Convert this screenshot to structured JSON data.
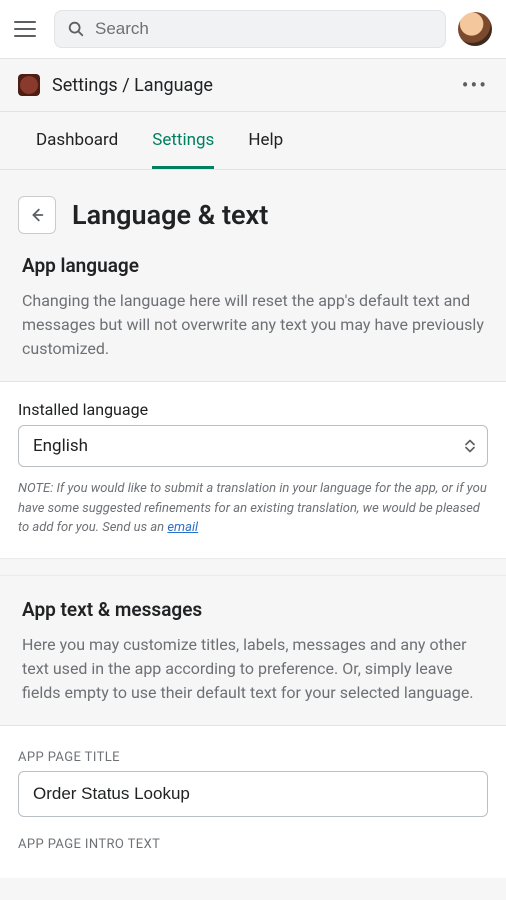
{
  "topbar": {
    "search_placeholder": "Search"
  },
  "breadcrumb": {
    "text": "Settings / Language"
  },
  "tabs": {
    "dashboard": "Dashboard",
    "settings": "Settings",
    "help": "Help"
  },
  "page": {
    "title": "Language & text"
  },
  "app_language": {
    "title": "App language",
    "description": "Changing the language here will reset the app's default text and messages but will not overwrite any text you may have previously customized.",
    "installed_label": "Installed language",
    "selected": "English",
    "note_prefix": "NOTE: If you would like to submit a translation in your language for the app, or if you have some suggested refinements for an existing translation, we would be pleased to add for you. Send us an ",
    "note_link": "email"
  },
  "app_text": {
    "title": "App text & messages",
    "description": "Here you may customize titles, labels, messages and any other text used in the app according to preference. Or, simply leave fields empty to use their default text for your selected language.",
    "field1_label": "APP PAGE TITLE",
    "field1_value": "Order Status Lookup",
    "field2_label": "APP PAGE INTRO TEXT"
  }
}
